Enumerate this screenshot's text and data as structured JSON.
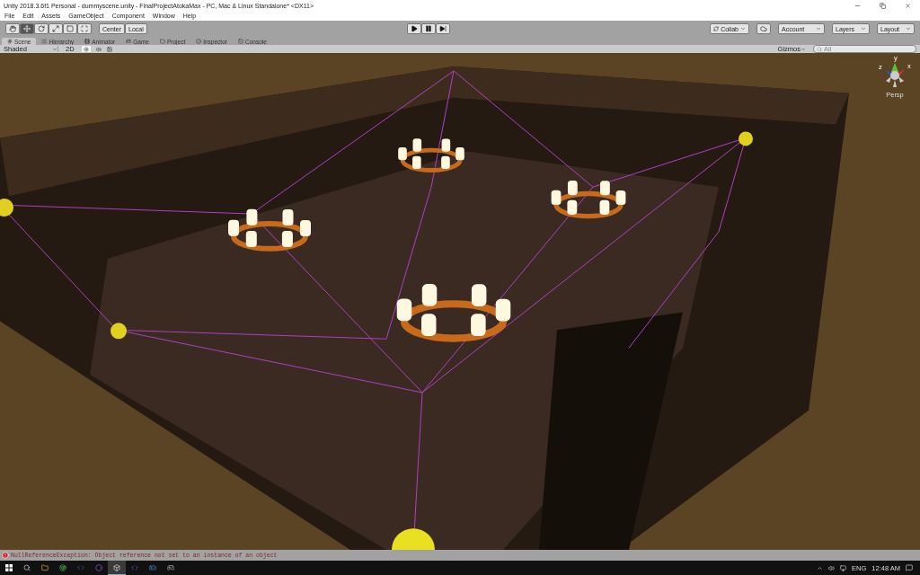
{
  "window": {
    "title": "Unity 2018.3.6f1 Personal - dummyscene.unity - FinalProjectAtokaMax - PC, Mac & Linux Standalone* <DX11>"
  },
  "menu": [
    "File",
    "Edit",
    "Assets",
    "GameObject",
    "Component",
    "Window",
    "Help"
  ],
  "tools": [
    {
      "kind": "hand",
      "selected": false
    },
    {
      "kind": "move",
      "selected": true
    },
    {
      "kind": "rotate",
      "selected": false
    },
    {
      "kind": "scale",
      "selected": false
    },
    {
      "kind": "rect",
      "selected": false
    },
    {
      "kind": "transform",
      "selected": false
    }
  ],
  "pivot": {
    "position": "Center",
    "rotation": "Local"
  },
  "play": [
    {
      "kind": "play"
    },
    {
      "kind": "pause"
    },
    {
      "kind": "step"
    }
  ],
  "cloud": {
    "collab": "Collab",
    "account": "Account",
    "layers": "Layers",
    "layout": "Layout"
  },
  "tabs": [
    {
      "label": "Scene",
      "selected": true
    },
    {
      "label": "Hierarchy",
      "selected": false
    },
    {
      "label": "Animator",
      "selected": false
    },
    {
      "label": "Game",
      "selected": false
    },
    {
      "label": "Project",
      "selected": false
    },
    {
      "label": "Inspector",
      "selected": false
    },
    {
      "label": "Console",
      "selected": false
    }
  ],
  "scene_toolbar": {
    "shading": "Shaded",
    "mode_2d": "2D",
    "lighting_on": true,
    "gizmos": "Gizmos",
    "search_placeholder": "All"
  },
  "gizmo": {
    "axes": [
      "y",
      "x",
      "z"
    ],
    "projection": "Persp"
  },
  "status": {
    "message": "NullReferenceException: Object reference not set to an instance of an object"
  },
  "taskbar": {
    "apps": [
      {
        "kind": "explorer",
        "selected": false
      },
      {
        "kind": "chrome",
        "selected": false
      },
      {
        "kind": "terminal",
        "selected": false
      },
      {
        "kind": "media",
        "selected": false
      },
      {
        "kind": "unity",
        "selected": true
      },
      {
        "kind": "visualstudio",
        "selected": false
      },
      {
        "kind": "steam",
        "selected": false
      },
      {
        "kind": "game",
        "selected": false
      }
    ],
    "language": "ENG",
    "time": "12:48 AM"
  }
}
